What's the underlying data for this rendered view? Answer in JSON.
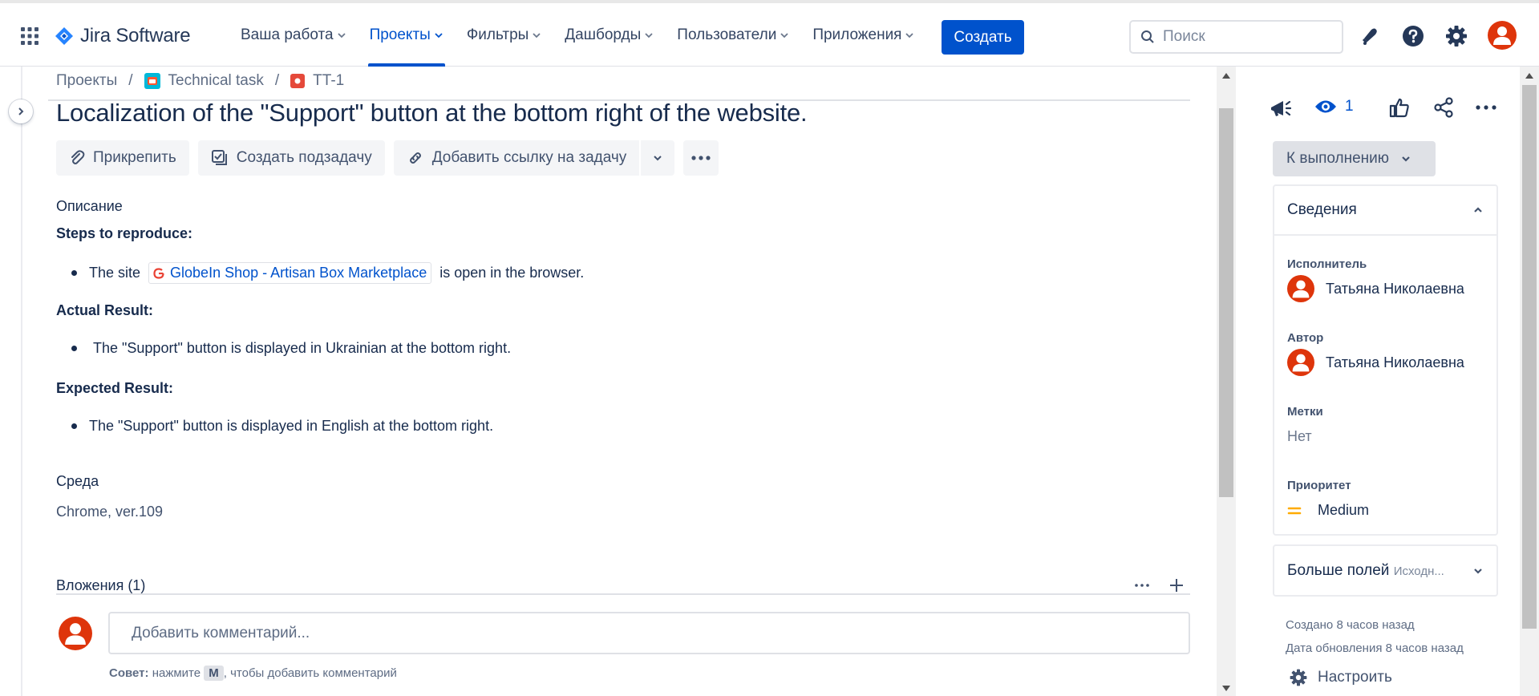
{
  "topbar": {
    "product_name": "Jira Software",
    "nav": [
      {
        "label": "Ваша работа",
        "active": false
      },
      {
        "label": "Проекты",
        "active": true
      },
      {
        "label": "Фильтры",
        "active": false
      },
      {
        "label": "Дашборды",
        "active": false
      },
      {
        "label": "Пользователи",
        "active": false
      },
      {
        "label": "Приложения",
        "active": false
      }
    ],
    "create_label": "Создать",
    "search_placeholder": "Поиск"
  },
  "breadcrumb": {
    "root": "Проекты",
    "project": "Technical task",
    "issue_key": "TT-1"
  },
  "issue": {
    "title": "Localization of the \"Support\" button at the bottom right of the website.",
    "actions": {
      "attach": "Прикрепить",
      "subtask": "Создать подзадачу",
      "link": "Добавить ссылку на задачу"
    },
    "description_label": "Описание",
    "steps_heading": "Steps to reproduce:",
    "step_prefix": "The site",
    "step_link": "GlobeIn Shop - Artisan Box Marketplace",
    "step_suffix": "is open in the browser.",
    "actual_heading": "Actual Result:",
    "actual_text": "The \"Support\" button is displayed in Ukrainian at the bottom right.",
    "expected_heading": "Expected Result:",
    "expected_text": "The \"Support\" button is displayed in English at the bottom right.",
    "environment_label": "Среда",
    "environment_value": "Chrome, ver.109",
    "attachments_label": "Вложения (1)",
    "comment_placeholder": "Добавить комментарий...",
    "tip_bold": "Совет:",
    "tip_before": "нажмите",
    "tip_key": "M",
    "tip_after": ", чтобы добавить комментарий"
  },
  "sidebar": {
    "watch_count": "1",
    "status": "К выполнению",
    "details_title": "Сведения",
    "assignee_label": "Исполнитель",
    "assignee": "Татьяна Николаевна",
    "reporter_label": "Автор",
    "reporter": "Татьяна Николаевна",
    "labels_label": "Метки",
    "labels_value": "Нет",
    "priority_label": "Приоритет",
    "priority": "Medium",
    "more_fields": "Больше полей",
    "more_fields_hint": "Исходн...",
    "created": "Создано 8 часов назад",
    "updated": "Дата обновления 8 часов назад",
    "configure": "Настроить"
  },
  "colors": {
    "brand": "#0052cc",
    "avatar": "#de350b",
    "priority": "#ffab00"
  }
}
